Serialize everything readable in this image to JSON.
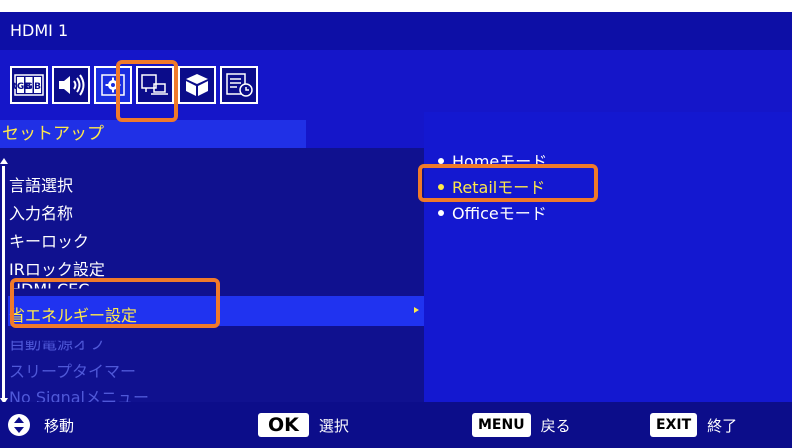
{
  "title": "HDMI 1",
  "section": "セットアップ",
  "tabs": [
    {
      "icon": "rgb-icon",
      "label": "RGB"
    },
    {
      "icon": "speaker-icon"
    },
    {
      "icon": "gear-icon",
      "selected": true
    },
    {
      "icon": "monitor-laptop-icon"
    },
    {
      "icon": "cube-icon"
    },
    {
      "icon": "schedule-icon"
    }
  ],
  "menu": {
    "items": [
      "言語選択",
      "入力名称",
      "キーロック",
      "IRロック設定",
      "HDMI CEC",
      "省エネルギー設定",
      "自動電源オフ",
      "スリープタイマー",
      "No Signalメニュー"
    ],
    "active": "省エネルギー設定"
  },
  "options": {
    "items": [
      "Homeモード",
      "Retailモード",
      "Officeモード"
    ],
    "active": "Retailモード"
  },
  "footer": {
    "move": "移動",
    "ok_key": "OK",
    "ok_label": "選択",
    "menu_key": "MENU",
    "menu_label": "戻る",
    "exit_key": "EXIT",
    "exit_label": "終了"
  },
  "colors": {
    "osd_blue": "#1516c9",
    "highlight_yellow": "#ffe94a",
    "callout_orange": "#f07a2a"
  }
}
